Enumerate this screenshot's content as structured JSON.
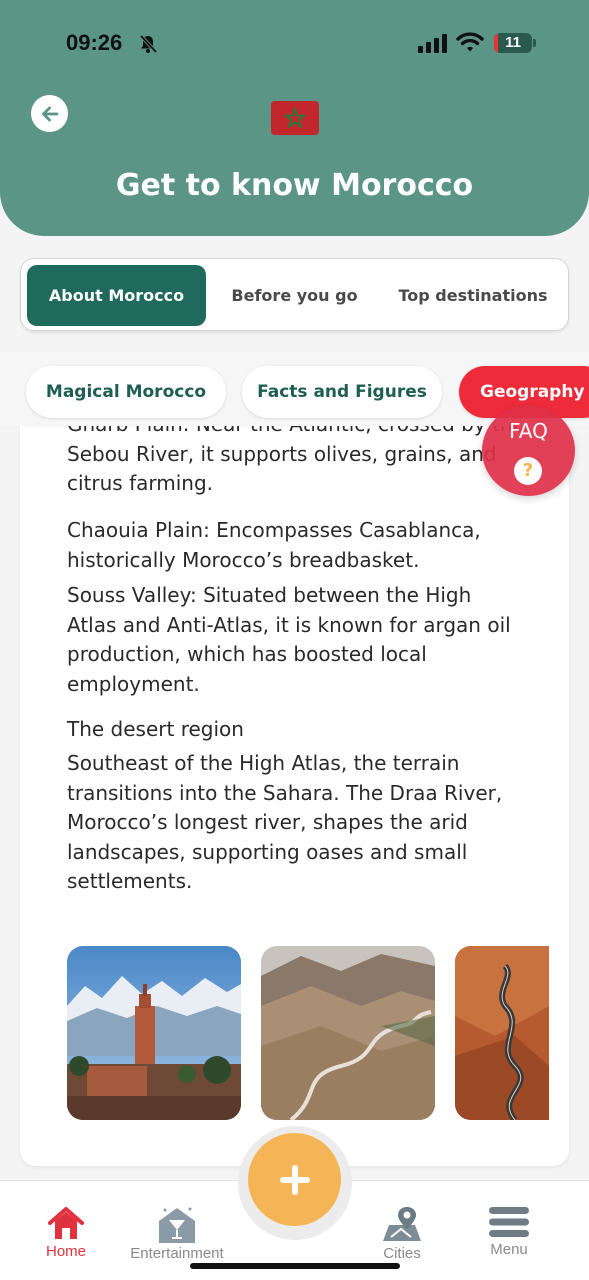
{
  "status_bar": {
    "time": "09:26",
    "battery": "11"
  },
  "header": {
    "title": "Get to know Morocco"
  },
  "tabs": [
    {
      "label": "About Morocco",
      "active": true
    },
    {
      "label": "Before you go",
      "active": false
    },
    {
      "label": "Top destinations",
      "active": false
    }
  ],
  "subtabs": [
    {
      "label": "Magical Morocco",
      "active": false
    },
    {
      "label": "Facts and Figures",
      "active": false
    },
    {
      "label": "Geography",
      "active": true
    }
  ],
  "content": {
    "gharb": "Gharb Plain: Near the Atlantic, crossed by the Sebou River, it supports olives, grains, and citrus farming.",
    "chaouia": "Chaouia Plain: Encompasses Casablanca, historically Morocco’s breadbasket.",
    "souss": "Souss Valley: Situated between the High Atlas and Anti-Atlas, it is known for argan oil production, which has boosted local employment.",
    "desert_heading": "The desert region",
    "desert_text": "Southeast of the High Atlas, the terrain transitions into the Sahara. The Draa River, Morocco’s longest river, shapes the arid landscapes, supporting oases and small settlements."
  },
  "faq": {
    "label": "FAQ",
    "icon": "question-icon",
    "symbol": "?"
  },
  "bottom_nav": [
    {
      "label": "Home",
      "icon": "home-icon",
      "active": true
    },
    {
      "label": "Entertainment",
      "icon": "entertainment-icon",
      "active": false
    },
    {
      "label": "Cities",
      "icon": "map-pin-icon",
      "active": false
    },
    {
      "label": "Menu",
      "icon": "menu-icon",
      "active": false
    }
  ],
  "colors": {
    "primary": "#5a9585",
    "active_tab": "#1f6a5c",
    "accent_red": "#ee2b3b",
    "fab": "#f5b556"
  }
}
